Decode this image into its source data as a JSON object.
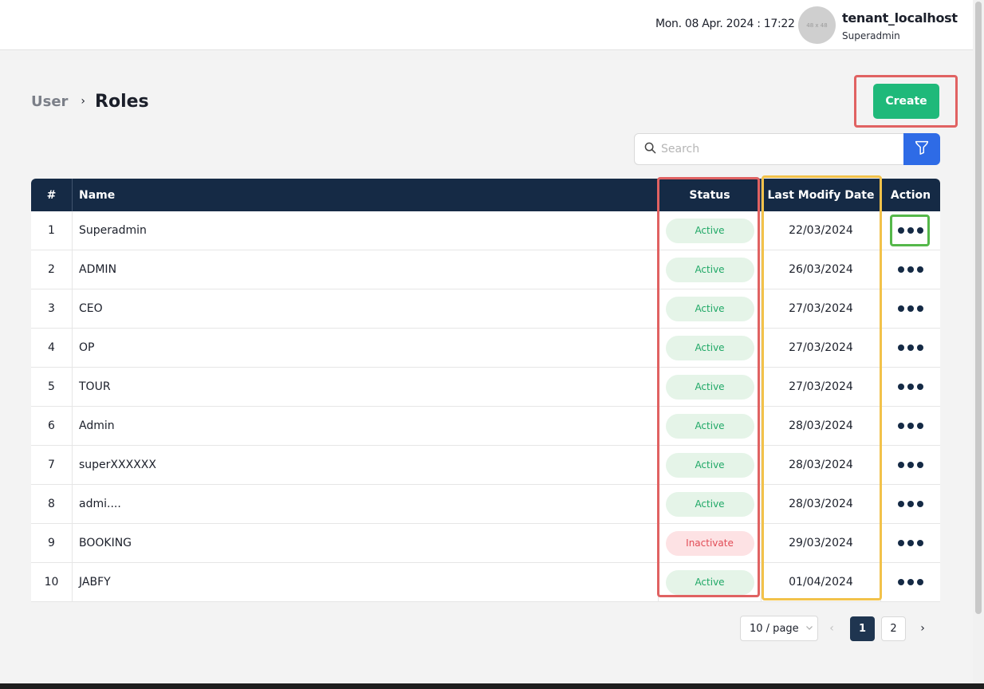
{
  "header": {
    "datetime": "Mon. 08 Apr. 2024 : 17:22",
    "avatar_placeholder": "48 x 48",
    "user_name": "tenant_localhost",
    "user_role": "Superadmin"
  },
  "breadcrumb": {
    "parent": "User",
    "separator": "›",
    "current": "Roles"
  },
  "actions": {
    "create_label": "Create"
  },
  "search": {
    "placeholder": "Search",
    "value": ""
  },
  "table": {
    "headers": {
      "num": "#",
      "name": "Name",
      "status": "Status",
      "date": "Last Modify Date",
      "action": "Action"
    },
    "rows": [
      {
        "num": "1",
        "name": "Superadmin",
        "status": "Active",
        "date": "22/03/2024"
      },
      {
        "num": "2",
        "name": "ADMIN",
        "status": "Active",
        "date": "26/03/2024"
      },
      {
        "num": "3",
        "name": "CEO",
        "status": "Active",
        "date": "27/03/2024"
      },
      {
        "num": "4",
        "name": "OP",
        "status": "Active",
        "date": "27/03/2024"
      },
      {
        "num": "5",
        "name": "TOUR",
        "status": "Active",
        "date": "27/03/2024"
      },
      {
        "num": "6",
        "name": "Admin",
        "status": "Active",
        "date": "28/03/2024"
      },
      {
        "num": "7",
        "name": "superXXXXXX",
        "status": "Active",
        "date": "28/03/2024"
      },
      {
        "num": "8",
        "name": "admi....",
        "status": "Active",
        "date": "28/03/2024"
      },
      {
        "num": "9",
        "name": "BOOKING",
        "status": "Inactivate",
        "date": "29/03/2024"
      },
      {
        "num": "10",
        "name": "JABFY",
        "status": "Active",
        "date": "01/04/2024"
      }
    ]
  },
  "pagination": {
    "page_size": "10 / page",
    "pages": [
      "1",
      "2"
    ],
    "current": "1",
    "prev": "‹",
    "next": "›"
  },
  "colors": {
    "accent_green": "#1fb97a",
    "header_navy": "#152a45",
    "filter_blue": "#2e6be6"
  },
  "icons": {
    "search": "search-icon",
    "filter": "filter-icon",
    "more": "more-dots-icon",
    "chevron": "chevron-down-icon"
  }
}
